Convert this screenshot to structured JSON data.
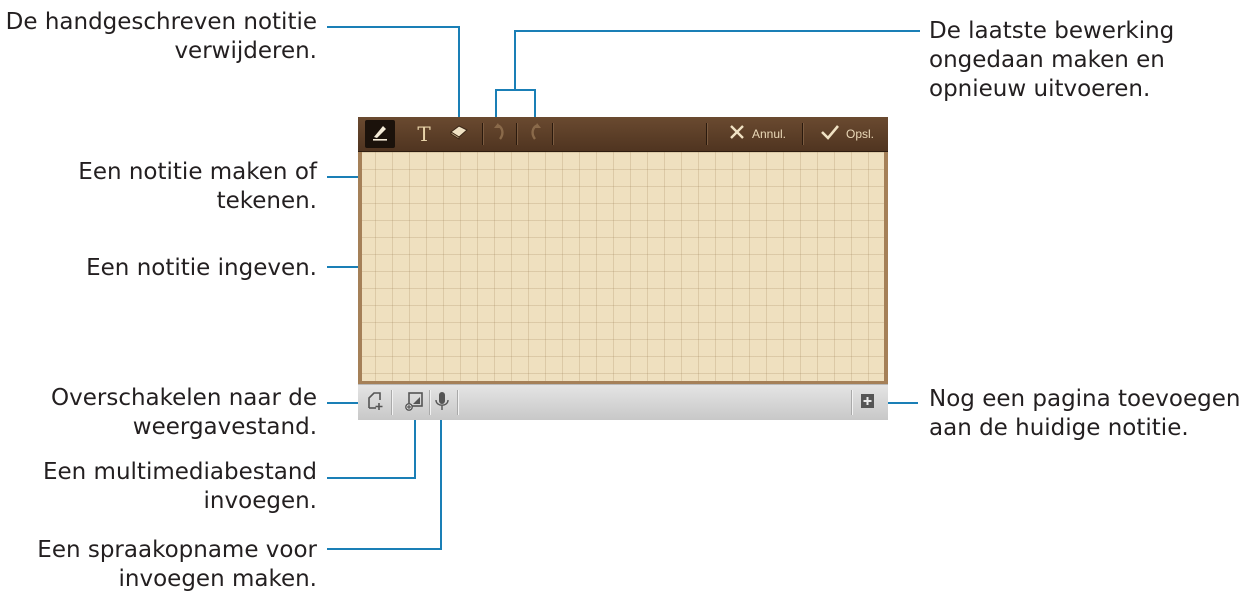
{
  "annotations": {
    "erase": [
      "De handgeschreven notitie",
      "verwijderen."
    ],
    "draw": [
      "Een notitie maken of",
      "tekenen."
    ],
    "text": [
      "Een notitie ingeven."
    ],
    "view_mode": [
      "Overschakelen naar de",
      "weergavestand."
    ],
    "media": [
      "Een multimediabestand",
      "invoegen."
    ],
    "voice": [
      "Een spraakopname voor",
      "invoegen maken."
    ],
    "undo_redo": [
      "De laatste bewerking",
      "ongedaan maken en",
      "opnieuw uitvoeren."
    ],
    "add_page": [
      "Nog een pagina toevoegen",
      "aan de huidige notitie."
    ]
  },
  "toolbar": {
    "text_tool_glyph": "T",
    "cancel_label": "Annul.",
    "save_label": "Opsl."
  },
  "colors": {
    "callout_line": "#1a7fb6",
    "toolbar": "#5c3e27",
    "paper": "#efe0bf"
  },
  "icons": [
    "pen-icon",
    "text-icon",
    "eraser-icon",
    "undo-icon",
    "redo-icon",
    "close-icon",
    "check-icon",
    "view-mode-icon",
    "insert-media-icon",
    "microphone-icon",
    "add-page-icon"
  ]
}
